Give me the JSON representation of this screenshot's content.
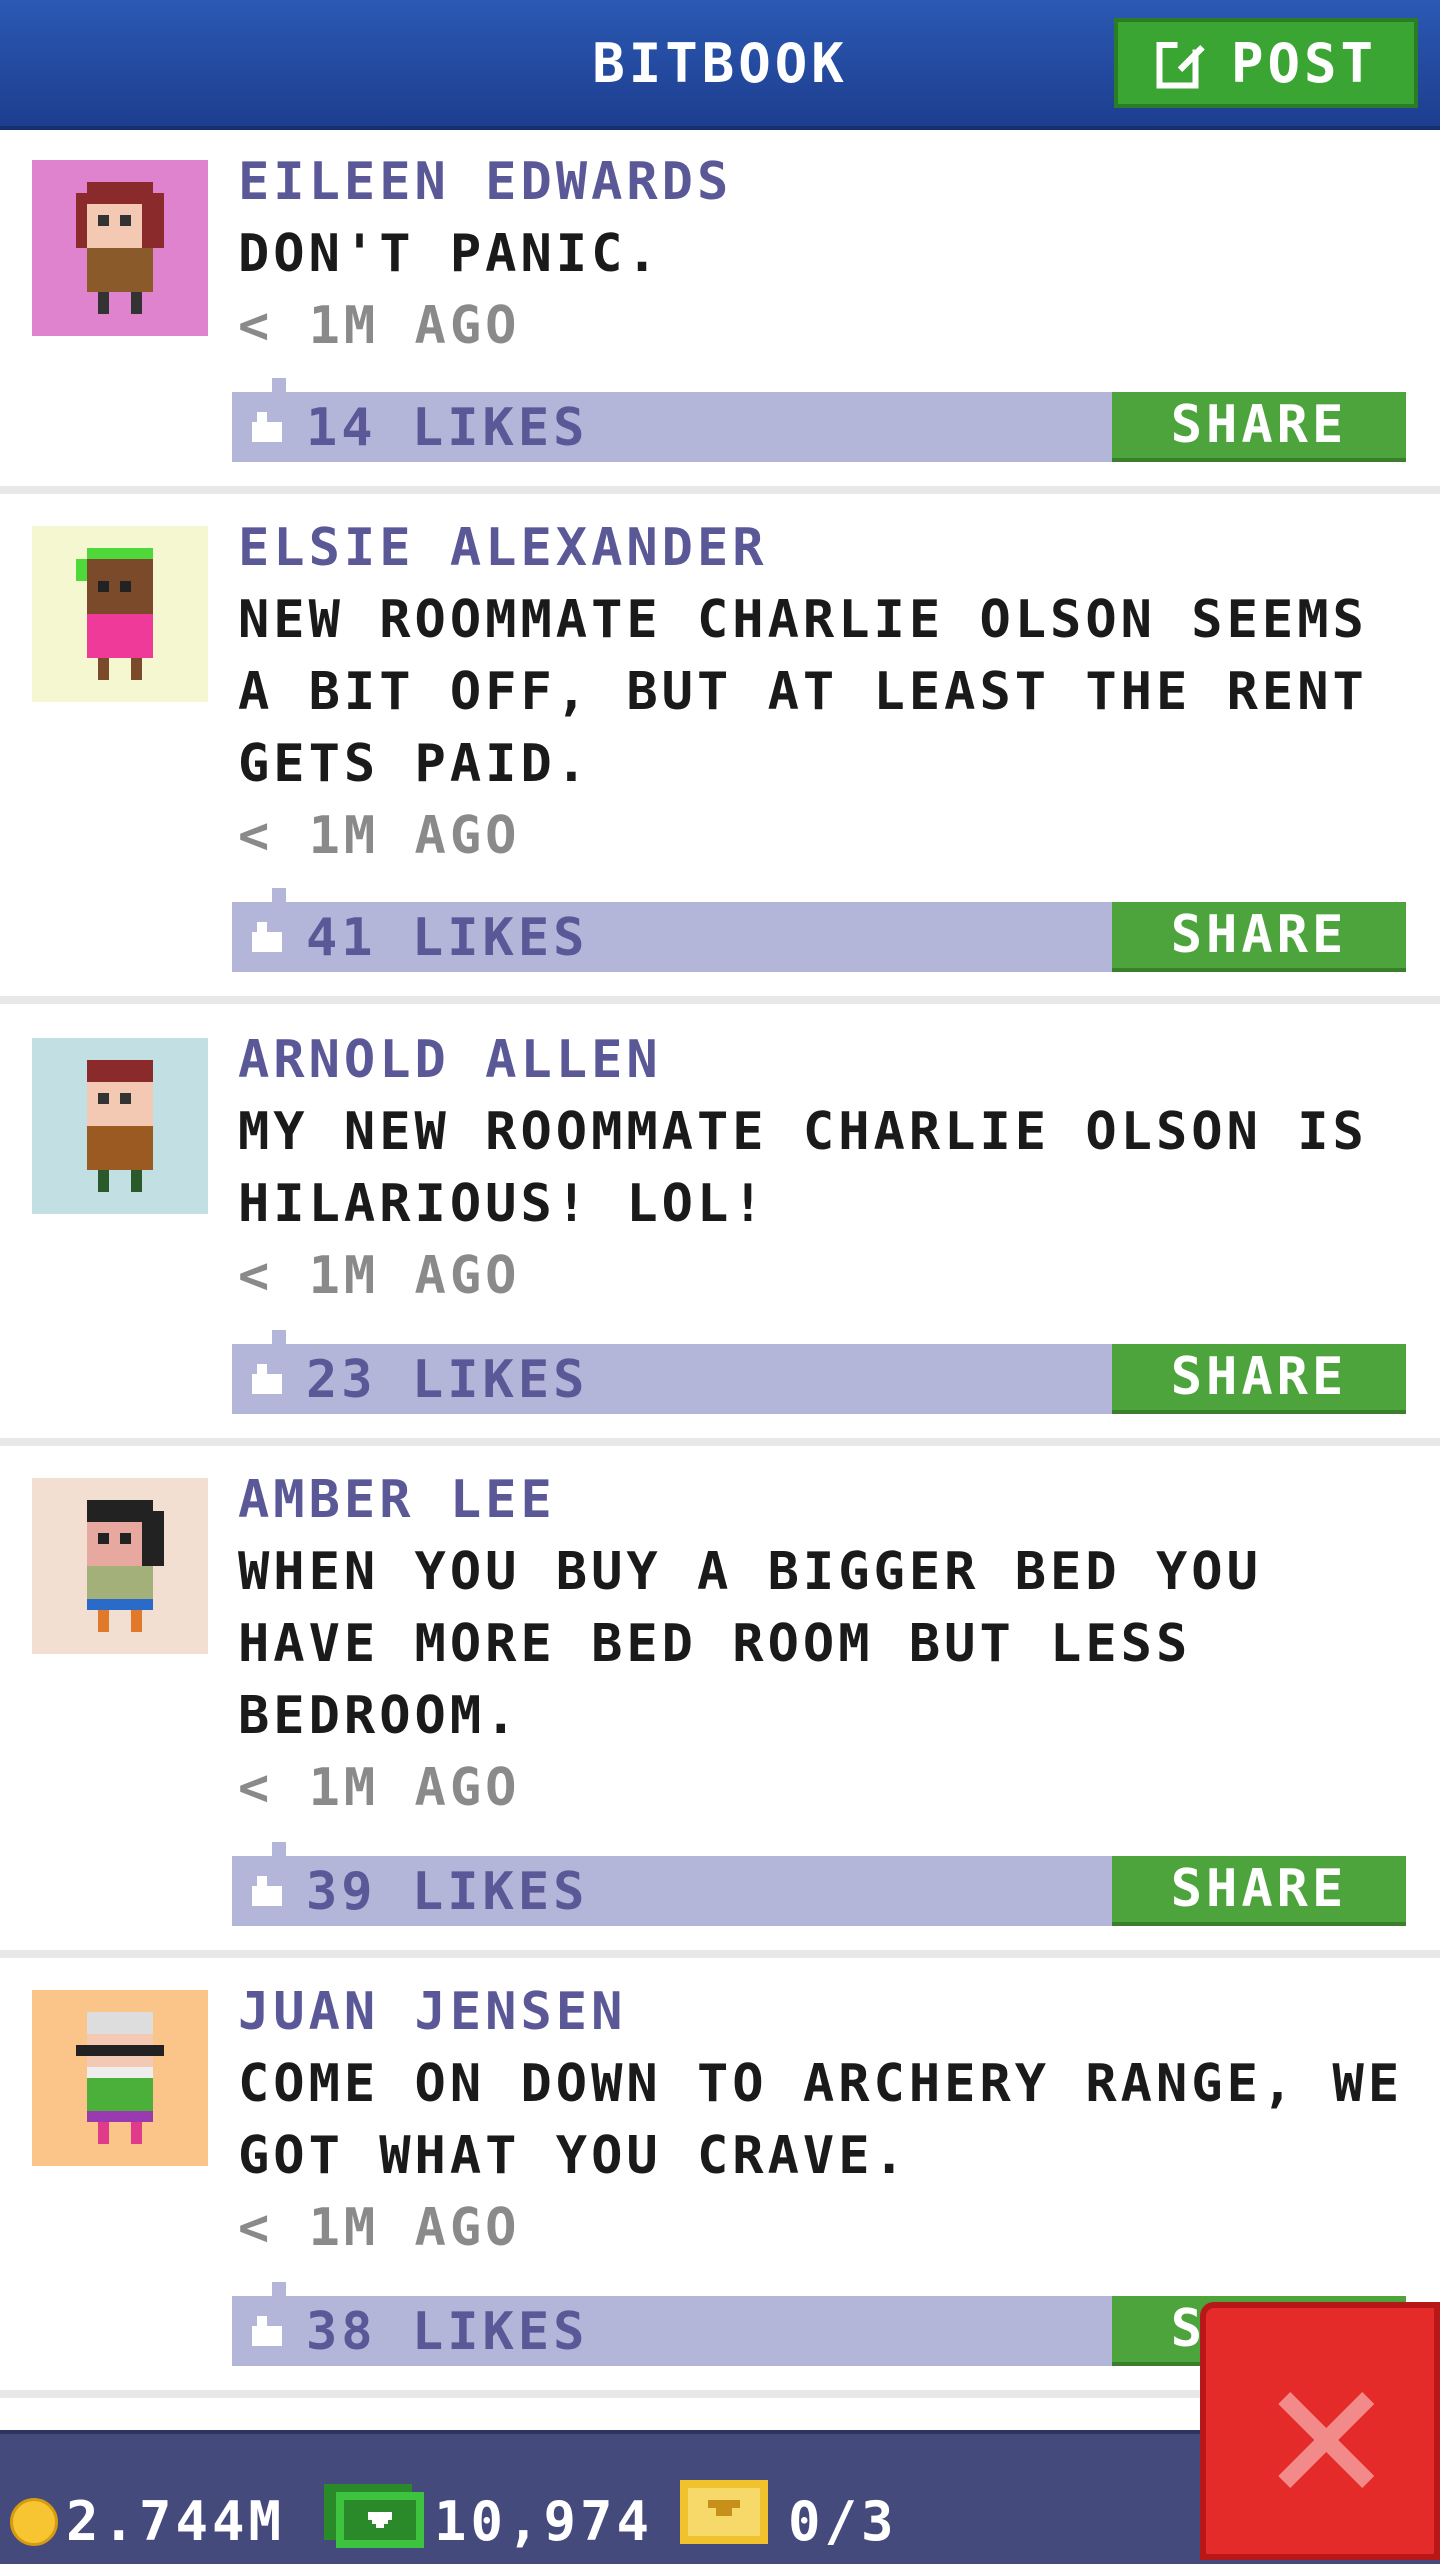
{
  "header": {
    "title": "BITBOOK",
    "post_label": "POST"
  },
  "posts": [
    {
      "author": "EILEEN EDWARDS",
      "text": "DON'T PANIC.",
      "time": "< 1M AGO",
      "likes": "14 LIKES",
      "share_label": "SHARE",
      "avatar_bg": "#e083cf"
    },
    {
      "author": "ELSIE ALEXANDER",
      "text": "NEW ROOMMATE CHARLIE OLSON SEEMS A BIT OFF, BUT AT LEAST THE RENT GETS PAID.",
      "time": "< 1M AGO",
      "likes": "41 LIKES",
      "share_label": "SHARE",
      "avatar_bg": "#f4f7d0"
    },
    {
      "author": "ARNOLD ALLEN",
      "text": "MY NEW ROOMMATE CHARLIE OLSON IS HILARIOUS! LOL!",
      "time": "< 1M AGO",
      "likes": "23 LIKES",
      "share_label": "SHARE",
      "avatar_bg": "#c2e0e4"
    },
    {
      "author": "AMBER LEE",
      "text": "WHEN YOU BUY A BIGGER BED YOU HAVE MORE BED ROOM BUT LESS BEDROOM.",
      "time": "< 1M AGO",
      "likes": "39 LIKES",
      "share_label": "SHARE",
      "avatar_bg": "#f3dfd2"
    },
    {
      "author": "JUAN JENSEN",
      "text": "COME ON DOWN TO ARCHERY RANGE, WE GOT WHAT YOU CRAVE.",
      "time": "< 1M AGO",
      "likes": "38 LIKES",
      "share_label": "SHARE",
      "avatar_bg": "#fbc58a"
    }
  ],
  "status": {
    "coins": "2.744M",
    "bux": "10,974",
    "tickets": "0/3"
  }
}
